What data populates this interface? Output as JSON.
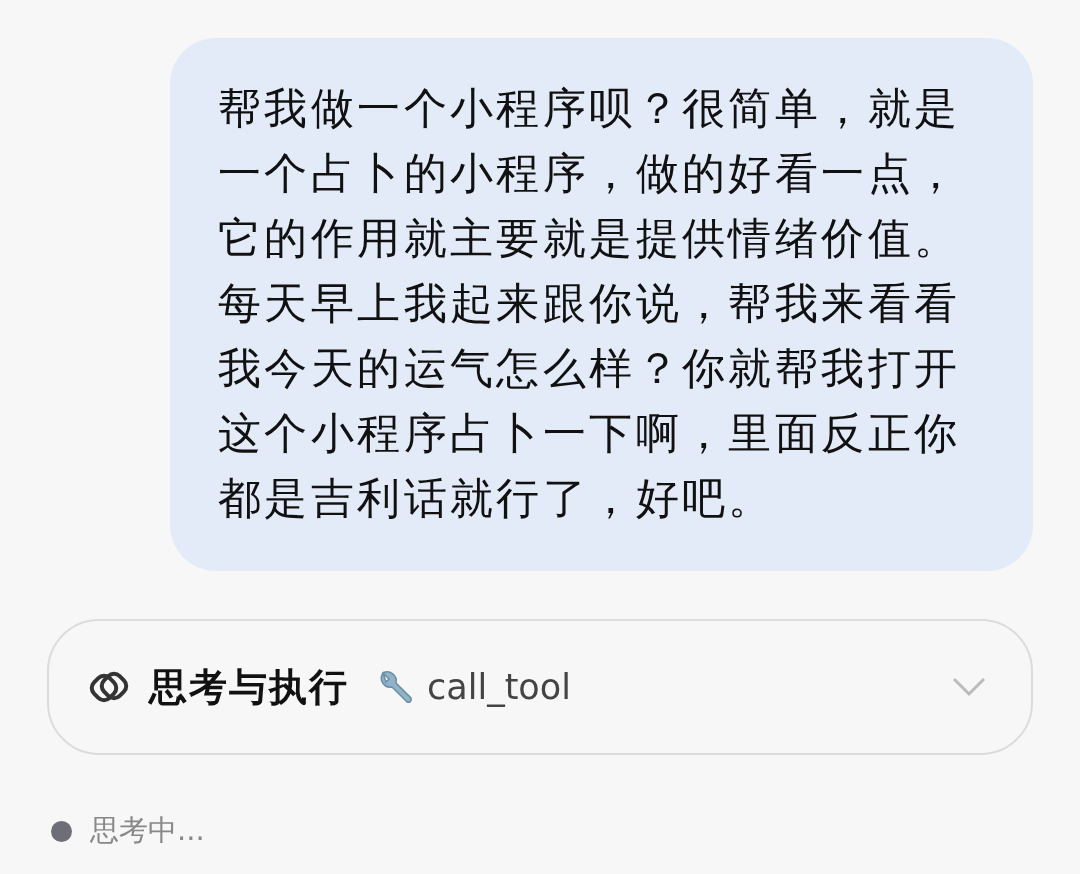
{
  "message": {
    "text": "帮我做一个小程序呗？很简单，就是一个占卜的小程序，做的好看一点，它的作用就主要就是提供情绪价值。每天早上我起来跟你说，帮我来看看我今天的运气怎么样？你就帮我打开这个小程序占卜一下啊，里面反正你都是吉利话就行了，好吧。"
  },
  "tool_card": {
    "title": "思考与执行",
    "tool": "call_tool",
    "expanded": false
  },
  "status": {
    "text": "思考中..."
  }
}
